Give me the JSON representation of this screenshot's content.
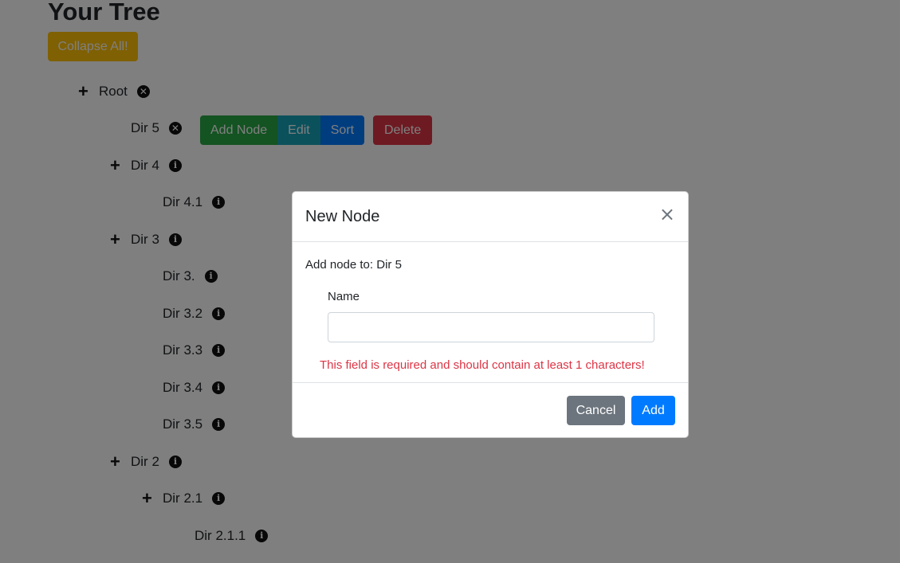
{
  "page": {
    "title": "Your Tree",
    "collapse_label": "Collapse All!"
  },
  "tree": {
    "nodes": [
      {
        "label": "Root",
        "icon": "close-circle-icon",
        "expandable": true
      },
      {
        "label": "Dir 5",
        "icon": "close-circle-icon",
        "expandable": false
      },
      {
        "label": "Dir 4",
        "icon": "info-circle-icon",
        "expandable": true
      },
      {
        "label": "Dir 4.1",
        "icon": "info-circle-icon",
        "expandable": false
      },
      {
        "label": "Dir 3",
        "icon": "info-circle-icon",
        "expandable": true
      },
      {
        "label": "Dir 3.",
        "icon": "info-circle-icon",
        "expandable": false
      },
      {
        "label": "Dir 3.2",
        "icon": "info-circle-icon",
        "expandable": false
      },
      {
        "label": "Dir 3.3",
        "icon": "info-circle-icon",
        "expandable": false
      },
      {
        "label": "Dir 3.4",
        "icon": "info-circle-icon",
        "expandable": false
      },
      {
        "label": "Dir 3.5",
        "icon": "info-circle-icon",
        "expandable": false
      },
      {
        "label": "Dir 2",
        "icon": "info-circle-icon",
        "expandable": true
      },
      {
        "label": "Dir 2.1",
        "icon": "info-circle-icon",
        "expandable": true
      },
      {
        "label": "Dir 2.1.1",
        "icon": "info-circle-icon",
        "expandable": false
      }
    ],
    "actions": {
      "add": "Add Node",
      "edit": "Edit",
      "sort": "Sort",
      "delete": "Delete"
    }
  },
  "modal": {
    "title": "New Node",
    "close_symbol": "×",
    "add_to_text": "Add node to: Dir 5",
    "field_label": "Name",
    "field_value": "",
    "field_placeholder": "",
    "error_text": "This field is required and should contain at least 1 characters!",
    "cancel_label": "Cancel",
    "confirm_label": "Add"
  },
  "colors": {
    "warning": "#ffc107",
    "success": "#28a745",
    "info": "#17a2b8",
    "primary": "#007bff",
    "danger": "#dc3545",
    "secondary": "#6c757d"
  }
}
